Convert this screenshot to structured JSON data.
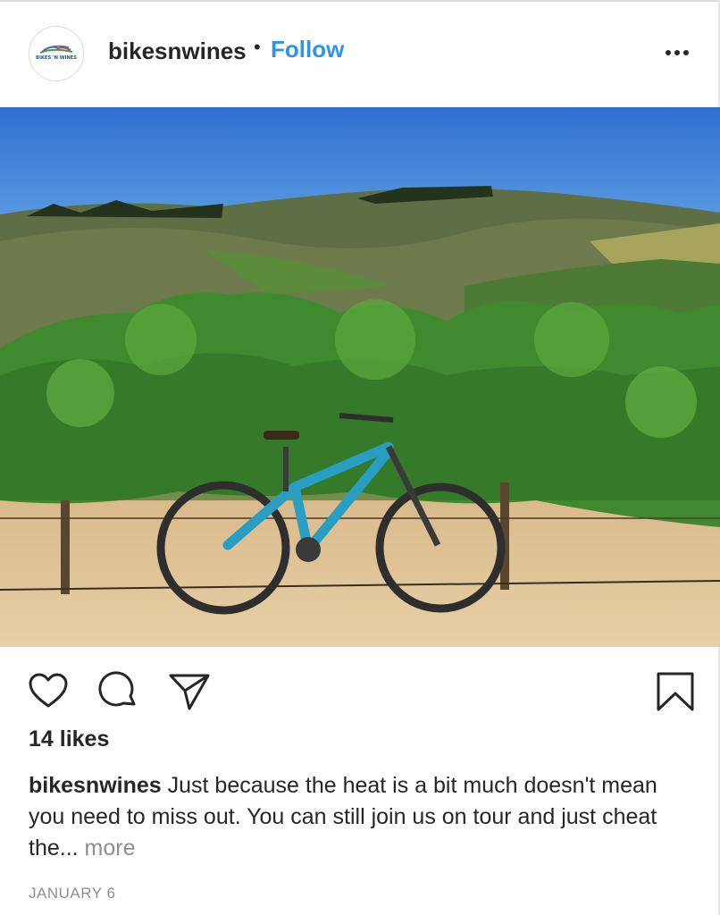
{
  "post": {
    "username": "bikesnwines",
    "separator": "•",
    "follow_label": "Follow",
    "avatar_logo_text": "BIKES 'N WINES",
    "more_icon": "ellipsis-icon",
    "likes": "14 likes",
    "caption_username": "bikesnwines",
    "caption_text": " Just because the heat is a bit much doesn't mean you need to miss out. You can still join us on tour and just cheat the... ",
    "caption_more": "more",
    "date": "JANUARY 6"
  },
  "actions": {
    "like_icon": "heart-icon",
    "comment_icon": "comment-icon",
    "share_icon": "paper-plane-icon",
    "save_icon": "bookmark-icon"
  },
  "colors": {
    "follow": "#2f93e6",
    "text": "#262626",
    "secondary": "#8e8e8e",
    "sky": "#3b7fd6"
  }
}
